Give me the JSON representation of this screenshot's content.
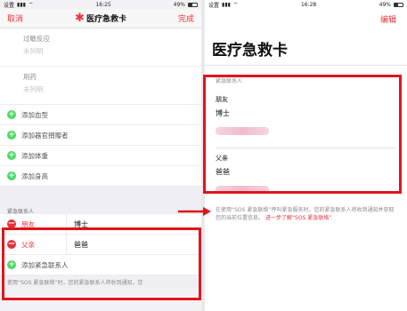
{
  "status": {
    "left": {
      "carrier": "设置",
      "time": "16:25",
      "battery": "49%"
    },
    "right": {
      "carrier": "设置",
      "time": "16:28",
      "battery": "49%"
    },
    "battery_level": 0.49
  },
  "left_screen": {
    "nav": {
      "cancel": "取消",
      "title": "医疗急救卡",
      "done": "完成"
    },
    "fields": [
      {
        "label": "过敏反应",
        "value": "未列明"
      },
      {
        "label": "用药",
        "value": "未列明"
      }
    ],
    "add_rows": [
      "添加血型",
      "添加器官捐赠者",
      "添加体重",
      "添加身高"
    ],
    "contacts_header": "紧急联系人",
    "contacts": [
      {
        "relation": "朋友",
        "name": "博士"
      },
      {
        "relation": "父亲",
        "name": "爸爸"
      }
    ],
    "add_contact": "添加紧急联系人",
    "footer": "使用“SOS 紧急联络”时，您的紧急联系人将收到通知，您"
  },
  "right_screen": {
    "edit": "编辑",
    "title": "医疗急救卡",
    "contacts_header": "紧急联系人",
    "contacts": [
      {
        "relation": "朋友",
        "name": "博士"
      },
      {
        "relation": "父亲",
        "name": "爸爸"
      }
    ],
    "footer_text": "在使用“SOS 紧急联络”呼叫紧急服务时，您的紧急联系人将收到通知并获取您的当前位置信息。",
    "footer_link": "进一步了解“SOS 紧急联络”"
  },
  "colors": {
    "accent": "#e8333a",
    "highlight": "#e2141d",
    "add": "#4cd964"
  }
}
